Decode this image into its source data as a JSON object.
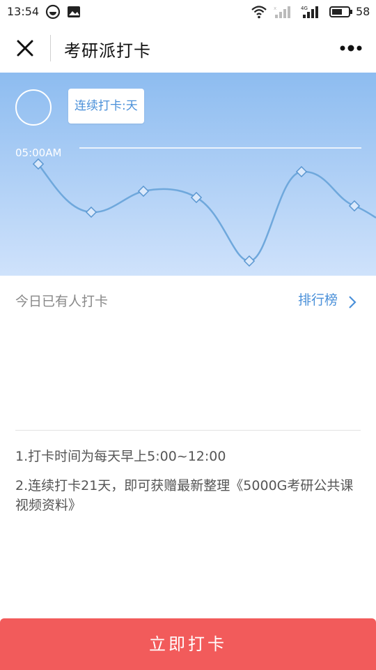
{
  "status_bar": {
    "time": "13:54",
    "battery_level": "58",
    "icons": [
      "app-notification-icon",
      "image-notification-icon",
      "wifi-icon",
      "signal-icon",
      "signal-4g-icon",
      "battery-icon"
    ]
  },
  "header": {
    "title": "考研派打卡",
    "close_icon": "close-icon",
    "more_icon": "more-dots-icon"
  },
  "banner": {
    "streak_text": "连续打卡:天",
    "time_label": "05:00AM",
    "colors": {
      "gradient_top": "#8dbcf0",
      "gradient_bottom": "#cfe2fb",
      "line": "#6fa8dc"
    }
  },
  "checkin": {
    "today_label": "今日已有人打卡",
    "ranking_label": "排行榜"
  },
  "rules": [
    "1.打卡时间为每天早上5:00~12:00",
    "2.连续打卡21天，即可获赠最新整理《5000G考研公共课视频资料》"
  ],
  "action": {
    "button_label": "立即打卡",
    "button_color": "#f25b5b"
  }
}
